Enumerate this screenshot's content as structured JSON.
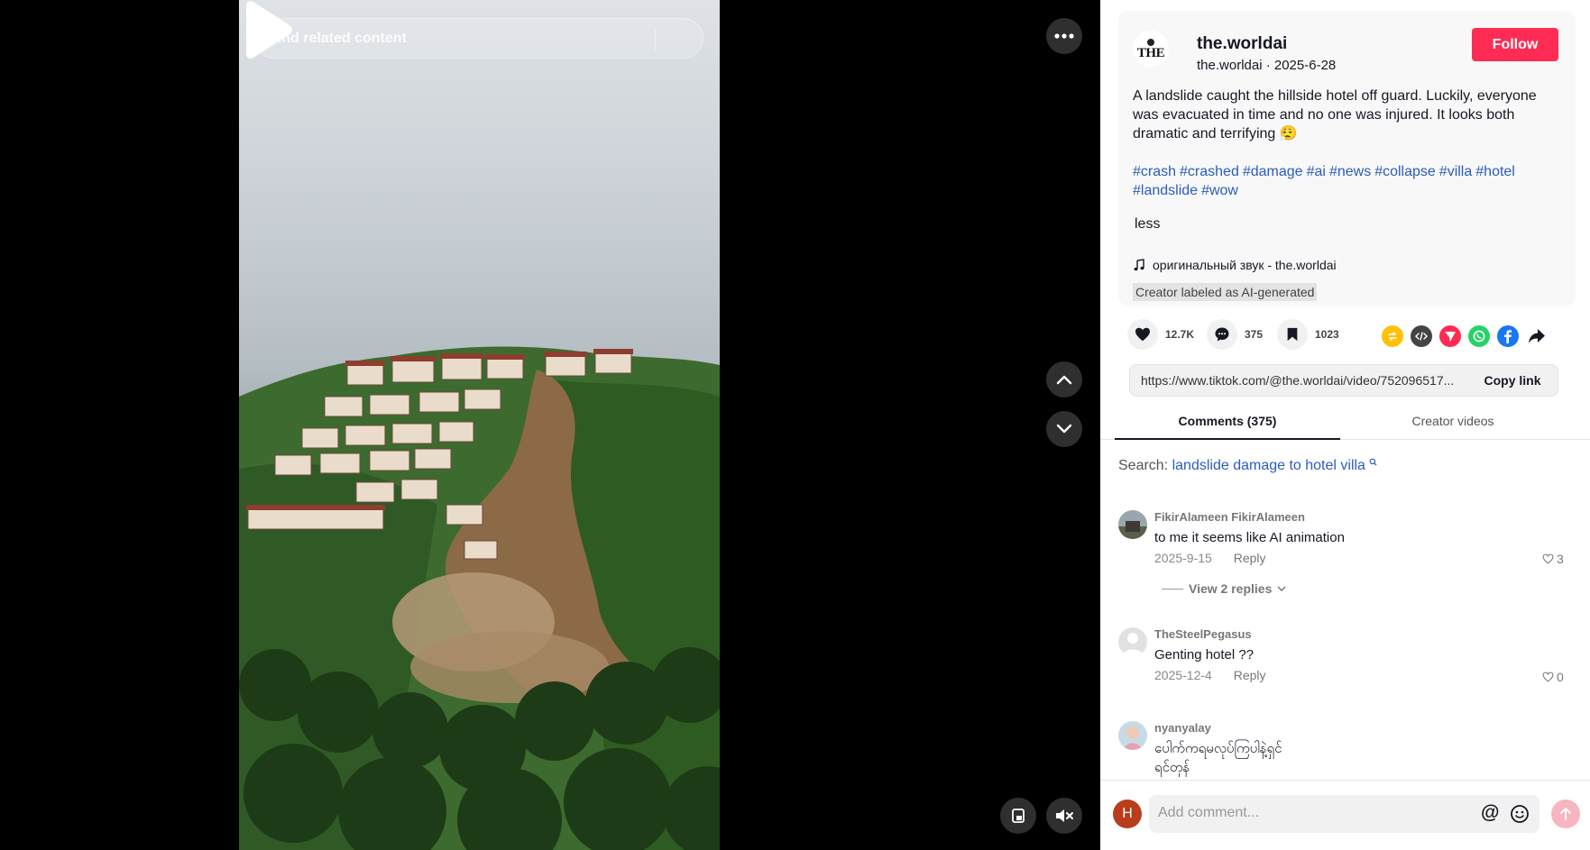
{
  "search": {
    "placeholder": "Find related content"
  },
  "author": {
    "display_name": "the.worldai",
    "subline": "the.worldai · 2025-6-28",
    "avatar_text": "THE",
    "follow_label": "Follow"
  },
  "caption": "A landslide caught the hillside hotel off guard. Luckily, everyone was evacuated in time and no one was injured. It looks both dramatic and terrifying 😮‍💨",
  "hashtags": [
    "#crash",
    "#crashed",
    "#damage",
    "#ai",
    "#news",
    "#collapse",
    "#villa",
    "#hotel",
    "#landslide",
    "#wow"
  ],
  "less_label": "less",
  "sound": "оригинальный звук - the.worldai",
  "ai_label": "Creator labeled as AI-generated",
  "stats": {
    "likes": "12.7K",
    "comments": "375",
    "saves": "1023"
  },
  "link": {
    "url": "https://www.tiktok.com/@the.worldai/video/752096517...",
    "copy_label": "Copy link"
  },
  "tabs": {
    "comments": "Comments (375)",
    "creator_videos": "Creator videos"
  },
  "related_search": {
    "prefix": "Search:",
    "keyword": "landslide damage to hotel villa"
  },
  "comments": [
    {
      "user": "FikirAlameen FikirAlameen",
      "text": "to me it seems like AI animation",
      "date": "2025-9-15",
      "reply": "Reply",
      "likes": "3",
      "view_replies": "View 2 replies"
    },
    {
      "user": "TheSteelPegasus",
      "text": "Genting hotel ??",
      "date": "2025-12-4",
      "reply": "Reply",
      "likes": "0"
    },
    {
      "user": "nyanyalay",
      "text_line1": "ပေါက်ကရမလုပ်ကြပါနဲ့ရှင်",
      "text_line2": "ရင်တုန်"
    }
  ],
  "composer": {
    "avatar_letter": "H",
    "placeholder": "Add comment...",
    "at_symbol": "@"
  },
  "colors": {
    "follow": "#fe2c55",
    "hashtag": "#2b5db9",
    "send_disabled": "#f7b5bf"
  },
  "icons": [
    "search-icon",
    "more-icon",
    "play-icon",
    "chevron-up-icon",
    "chevron-down-icon",
    "pip-icon",
    "mute-icon",
    "heart-icon",
    "comment-icon",
    "bookmark-icon",
    "repost-icon",
    "embed-icon",
    "send-to-icon",
    "whatsapp-icon",
    "facebook-icon",
    "share-arrow-icon",
    "music-note-icon",
    "heart-outline-icon",
    "emoji-icon",
    "send-arrow-icon"
  ]
}
